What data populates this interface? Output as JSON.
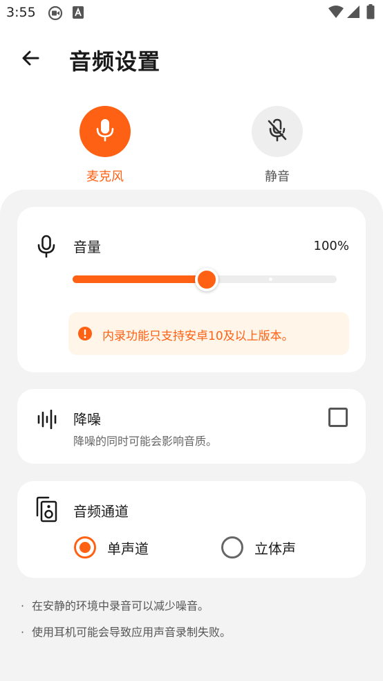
{
  "status_bar": {
    "time": "3:55",
    "icons": [
      "screen-record-icon",
      "a-box-icon",
      "wifi-icon",
      "signal-icon",
      "battery-icon"
    ]
  },
  "app_bar": {
    "title": "音频设置",
    "back_icon": "arrow-left-icon"
  },
  "modes": [
    {
      "label": "麦克风",
      "icon": "microphone-icon",
      "selected": true
    },
    {
      "label": "静音",
      "icon": "microphone-off-icon",
      "selected": false
    }
  ],
  "volume": {
    "title": "音量",
    "value_text": "100%",
    "slider_level": 0.5,
    "notice": "内录功能只支持安卓10及以上版本。"
  },
  "noise": {
    "title": "降噪",
    "subtitle": "降噪的同时可能会影响音质。",
    "checked": false
  },
  "channel": {
    "title": "音频通道",
    "options": [
      {
        "label": "单声道",
        "selected": true
      },
      {
        "label": "立体声",
        "selected": false
      }
    ]
  },
  "tips": [
    "在安静的环境中录音可以减少噪音。",
    "使用耳机可能会导致应用声音录制失败。"
  ],
  "colors": {
    "accent": "#ff6114",
    "notice_bg": "#fff5e9",
    "sheet_bg": "#f3f3f3"
  }
}
